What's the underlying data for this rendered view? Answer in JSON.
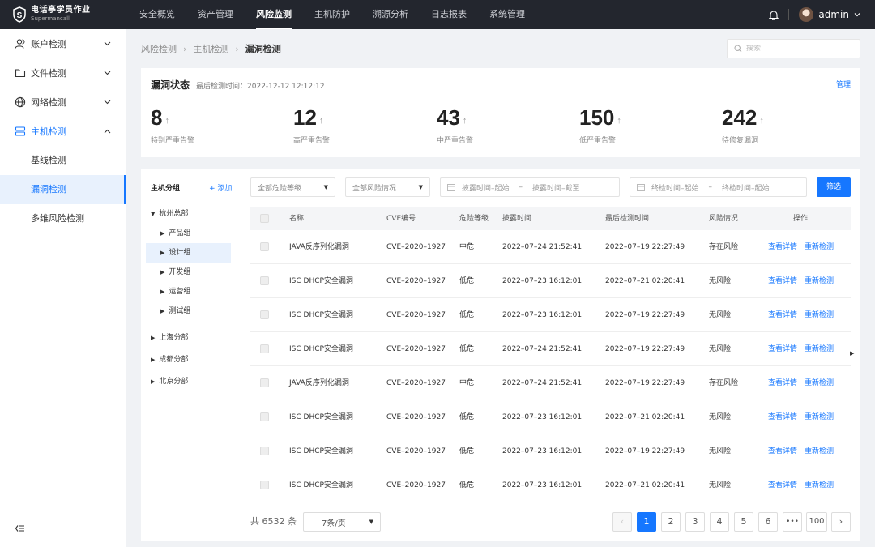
{
  "app": {
    "name": "电话亭学员作业",
    "sub": "Supermancall"
  },
  "nav": [
    {
      "label": "安全概览",
      "active": false
    },
    {
      "label": "资产管理",
      "active": false
    },
    {
      "label": "风险监测",
      "active": true
    },
    {
      "label": "主机防护",
      "active": false
    },
    {
      "label": "溯源分析",
      "active": false
    },
    {
      "label": "日志报表",
      "active": false
    },
    {
      "label": "系统管理",
      "active": false
    }
  ],
  "user": {
    "name": "admin"
  },
  "sidebar": {
    "items": [
      {
        "label": "账户检测",
        "icon": "user-icon"
      },
      {
        "label": "文件检测",
        "icon": "folder-icon"
      },
      {
        "label": "网络检测",
        "icon": "globe-icon"
      },
      {
        "label": "主机检测",
        "icon": "server-icon"
      }
    ],
    "sub": [
      {
        "label": "基线检测"
      },
      {
        "label": "漏洞检测"
      },
      {
        "label": "多维风险检测"
      }
    ]
  },
  "breadcrumb": [
    "风险检测",
    "主机检测",
    "漏洞检测"
  ],
  "search": {
    "placeholder": "搜索"
  },
  "status": {
    "title": "漏洞状态",
    "time": "最后检测时间：2022-12-12 12:12:12",
    "manage": "管理",
    "stats": [
      {
        "value": "8",
        "label": "特别严重告警"
      },
      {
        "value": "12",
        "label": "高严重告警"
      },
      {
        "value": "43",
        "label": "中严重告警"
      },
      {
        "value": "150",
        "label": "低严重告警"
      },
      {
        "value": "242",
        "label": "待修复漏洞"
      }
    ]
  },
  "tree": {
    "title": "主机分组",
    "add": "+ 添加",
    "nodes": [
      "杭州总部",
      "产品组",
      "设计组",
      "开发组",
      "运营组",
      "测试组",
      "上海分部",
      "成都分部",
      "北京分部"
    ]
  },
  "filters": {
    "level": "全部危险等级",
    "risk": "全部风险情况",
    "start1": "披露时间–起始",
    "end1": "披露时间–截至",
    "start2": "终检时间–起始",
    "end2": "终检时间–起始",
    "dash": "–",
    "button": "筛选"
  },
  "table": {
    "headers": [
      "名称",
      "CVE编号",
      "危险等级",
      "披露时间",
      "最后检测时间",
      "风险情况",
      "操作"
    ],
    "actions": [
      "查看详情",
      "重新检测"
    ],
    "rows": [
      [
        "JAVA反序列化漏洞",
        "CVE–2020–1927",
        "中危",
        "2022–07–24 21:52:41",
        "2022–07–19 22:27:49",
        "存在风险"
      ],
      [
        "ISC DHCP安全漏洞",
        "CVE–2020–1927",
        "低危",
        "2022–07–23 16:12:01",
        "2022–07–21 02:20:41",
        "无风险"
      ],
      [
        "ISC DHCP安全漏洞",
        "CVE–2020–1927",
        "低危",
        "2022–07–23 16:12:01",
        "2022–07–19 22:27:49",
        "无风险"
      ],
      [
        "ISC DHCP安全漏洞",
        "CVE–2020–1927",
        "低危",
        "2022–07–24 21:52:41",
        "2022–07–19 22:27:49",
        "无风险"
      ],
      [
        "JAVA反序列化漏洞",
        "CVE–2020–1927",
        "中危",
        "2022–07–24 21:52:41",
        "2022–07–19 22:27:49",
        "存在风险"
      ],
      [
        "ISC DHCP安全漏洞",
        "CVE–2020–1927",
        "低危",
        "2022–07–23 16:12:01",
        "2022–07–21 02:20:41",
        "无风险"
      ],
      [
        "ISC DHCP安全漏洞",
        "CVE–2020–1927",
        "低危",
        "2022–07–23 16:12:01",
        "2022–07–19 22:27:49",
        "无风险"
      ],
      [
        "ISC DHCP安全漏洞",
        "CVE–2020–1927",
        "低危",
        "2022–07–23 16:12:01",
        "2022–07–21 02:20:41",
        "无风险"
      ]
    ]
  },
  "pagination": {
    "total": "共 6532 条",
    "per_page": "7条/页",
    "pages": [
      "1",
      "2",
      "3",
      "4",
      "5",
      "6",
      "•••",
      "100"
    ],
    "prev": "‹",
    "next": "›"
  },
  "colors": {
    "accent": "#1677ff",
    "topbar": "#23262e"
  }
}
